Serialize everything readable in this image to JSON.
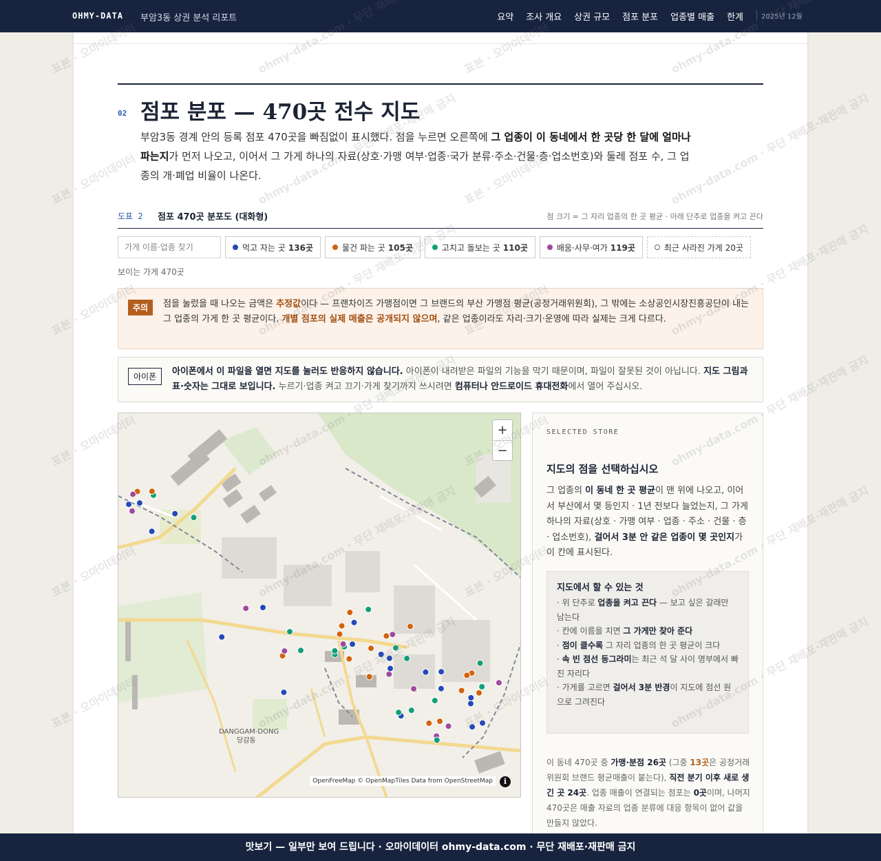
{
  "header": {
    "brand": "OHMY-DATA",
    "report_title": "부암3동 상권 분석 리포트",
    "nav": [
      "요약",
      "조사 개요",
      "상권 규모",
      "점포 분포",
      "업종별 매출",
      "한계"
    ],
    "date": "2025년 12월"
  },
  "section": {
    "number": "02",
    "title": "점포 분포 — 470곳 전수 지도",
    "lead": {
      "p1": "부암3동 경계 안의 등록 점포 470곳을 빠짐없이 표시했다. 점을 누르면 오른쪽에 ",
      "b1": "그 업종이 이 동네에서 한 곳당 한 달에 얼마나 파는지",
      "p2": "가 먼저 나오고, 이어서 그 가게 하나의 자료(상호·가맹 여부·업종·국가 분류·주소·건물·층·업소번호)와 둘레 점포 수, 그 업종의 개·폐업 비율이 나온다."
    }
  },
  "figure": {
    "tag": "도표 2",
    "title": "점포 470곳 분포도 (대화형)",
    "note": "점 크기 = 그 자리 업종의 한 곳 평균 · 아래 단추로 업종을 켜고 끈다",
    "search_placeholder": "가게 이름·업종 찾기",
    "filters": [
      {
        "label": "먹고 자는 곳",
        "count": "136곳",
        "color": "#2449b8"
      },
      {
        "label": "물건 파는 곳",
        "count": "105곳",
        "color": "#d2640f"
      },
      {
        "label": "고치고 돌보는 곳",
        "count": "110곳",
        "color": "#139e7a"
      },
      {
        "label": "배움·사무·여가",
        "count": "119곳",
        "color": "#a04a9e"
      }
    ],
    "closed_filter": {
      "label": "최근 사라진 가게",
      "count": "20곳"
    },
    "visible_count": "보이는 가게 470곳"
  },
  "warning": {
    "tag": "주의",
    "t1": "점을 눌렀을 때 나오는 금액은 ",
    "b1": "추정값",
    "t2": "이다 — 프랜차이즈 가맹점이면 그 브랜드의 부산 가맹점 평균(공정거래위원회), 그 밖에는 소상공인시장진흥공단이 내는 그 업종의 가게 한 곳 평균이다. ",
    "b2": "개별 점포의 실제 매출은 공개되지 않으며",
    "t3": ", 같은 업종이라도 자리·크기·운영에 따라 실제는 크게 다르다."
  },
  "iphone": {
    "tag": "아이폰",
    "b1": "아이폰에서 이 파일을 열면 지도를 눌러도 반응하지 않습니다.",
    "t1": " 아이폰이 내려받은 파일의 기능을 막기 때문이며, 파일이 잘못된 것이 아닙니다. ",
    "b2": "지도 그림과 표·숫자는 그대로 보입니다.",
    "t2": " 누르기·업종 켜고 끄기·가게 찾기까지 쓰시려면 ",
    "b3": "컴퓨터나 안드로이드 휴대전화",
    "t3": "에서 열어 주십시오."
  },
  "map": {
    "zoom_in": "+",
    "zoom_out": "−",
    "place_en": "DANGGAM-DONG",
    "place_ko": "당감동",
    "attribution": "OpenFreeMap © OpenMapTiles Data from OpenStreetMap",
    "info": "i",
    "markers": [
      {
        "c": "blue"
      },
      {
        "c": "blue"
      },
      {
        "c": "purple"
      },
      {
        "c": "green"
      },
      {
        "c": "orange"
      },
      {
        "c": "blue"
      },
      {
        "c": "green"
      },
      {
        "c": "blue"
      },
      {
        "c": "orange"
      },
      {
        "c": "purple"
      },
      {
        "c": "orange"
      },
      {
        "c": "orange"
      },
      {
        "c": "blue"
      },
      {
        "c": "orange"
      },
      {
        "c": "green"
      },
      {
        "c": "blue"
      },
      {
        "c": "purple"
      },
      {
        "c": "green"
      },
      {
        "c": "orange"
      },
      {
        "c": "blue"
      },
      {
        "c": "orange"
      },
      {
        "c": "green"
      },
      {
        "c": "orange"
      },
      {
        "c": "purple"
      },
      {
        "c": "orange"
      },
      {
        "c": "green"
      },
      {
        "c": "blue"
      },
      {
        "c": "blue"
      },
      {
        "c": "green"
      },
      {
        "c": "orange"
      },
      {
        "c": "purple"
      },
      {
        "c": "green"
      },
      {
        "c": "blue"
      },
      {
        "c": "green"
      },
      {
        "c": "orange"
      },
      {
        "c": "blue"
      },
      {
        "c": "purple"
      },
      {
        "c": "orange"
      },
      {
        "c": "green"
      },
      {
        "c": "blue"
      },
      {
        "c": "green"
      },
      {
        "c": "orange"
      },
      {
        "c": "purple"
      },
      {
        "c": "blue"
      },
      {
        "c": "green"
      },
      {
        "c": "blue"
      },
      {
        "c": "orange"
      },
      {
        "c": "blue"
      },
      {
        "c": "green"
      },
      {
        "c": "purple"
      },
      {
        "c": "blue"
      },
      {
        "c": "orange"
      },
      {
        "c": "green"
      },
      {
        "c": "blue"
      },
      {
        "c": "purple"
      },
      {
        "c": "blue"
      },
      {
        "c": "orange"
      },
      {
        "c": "purple"
      },
      {
        "c": "blue"
      },
      {
        "c": "green"
      },
      {
        "c": "orange"
      },
      {
        "c": "blue"
      },
      {
        "c": "purple"
      },
      {
        "c": "orange"
      },
      {
        "c": "green"
      }
    ]
  },
  "panel": {
    "kicker": "SELECTED STORE",
    "title": "지도의 점을 선택하십시오",
    "t1": "그 업종의 ",
    "b1": "이 동네 한 곳 평균",
    "t2": "이 맨 위에 나오고, 이어서 부산에서 몇 등인지 · 1년 전보다 늘었는지, 그 가게 하나의 자료(상호 · 가맹 여부 · 업종 · 주소 · 건물 · 층 · 업소번호), ",
    "b2": "걸어서 3분 안 같은 업종이 몇 곳인지",
    "t3": "가 이 칸에 표시된다.",
    "howto_title": "지도에서 할 수 있는 것",
    "howto": [
      {
        "t1": "· 위 단추로 ",
        "b": "업종을 켜고 끈다",
        "t2": " — 보고 싶은 갈래만 남는다"
      },
      {
        "t1": "· 칸에 이름을 치면 ",
        "b": "그 가게만 찾아 준다",
        "t2": ""
      },
      {
        "t1": "· ",
        "b": "점이 클수록",
        "t2": " 그 자리 업종의 한 곳 평균이 크다"
      },
      {
        "t1": "· ",
        "b": "속 빈 점선 동그라미",
        "t2": "는 최근 석 달 사이 명부에서 빠진 자리다"
      },
      {
        "t1": "· 가게를 고르면 ",
        "b": "걸어서 3분 반경",
        "t2": "이 지도에 점선 원으로 그려진다"
      }
    ],
    "foot": {
      "t1": "이 동네 470곳 중 ",
      "b1": "가맹·분점 26곳",
      "t2": " (그중 ",
      "b2": "13곳",
      "t3": "은 공정거래위원회 브랜드 평균매출이 붙는다), ",
      "b3": "직전 분기 이후 새로 생긴 곳 24곳",
      "t4": ". 업종 매출이 연결되는 점포는 ",
      "b4": "0곳",
      "t5": "이며, 나머지 470곳은 매출 자료의 업종 분류에 대응 항목이 없어 값을 만들지 않았다."
    }
  },
  "footer": "맛보기 — 일부만 보여 드립니다 · 오마이데이터 ohmy-data.com · 무단 재배포·재판매 금지",
  "watermark": {
    "a": "표본 · 오마이데이터",
    "b": "ohmy-data.com · 무단 재배포·재판매 금지"
  }
}
